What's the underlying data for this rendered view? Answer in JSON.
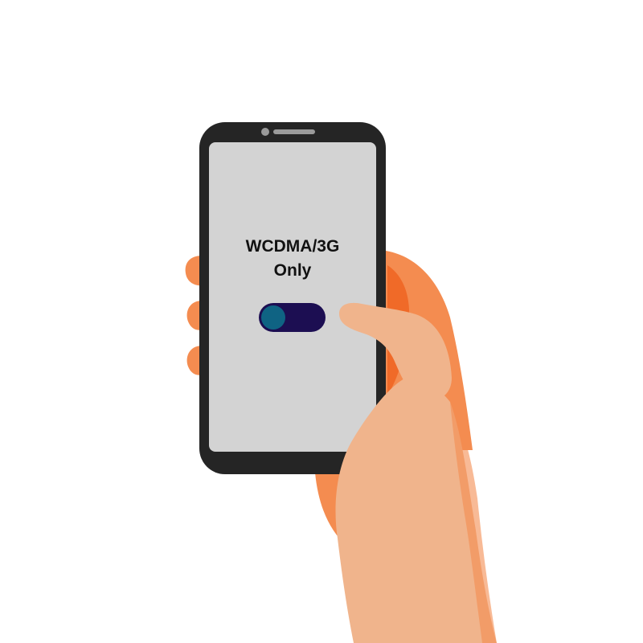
{
  "screen": {
    "line1": "WCDMA/3G",
    "line2": "Only"
  },
  "toggle": {
    "state": "off",
    "knob_side": "left"
  },
  "colors": {
    "background": "#ffffff",
    "phone_body": "#252525",
    "screen": "#d3d3d3",
    "toggle_track": "#1c0e52",
    "toggle_knob": "#0f6383",
    "skin": "#f0b48c",
    "palm_shadow": "#f48c50",
    "dark_orange": "#f06a28"
  },
  "icons": {
    "camera": "front-camera-icon",
    "speaker": "earpiece-speaker-icon"
  }
}
